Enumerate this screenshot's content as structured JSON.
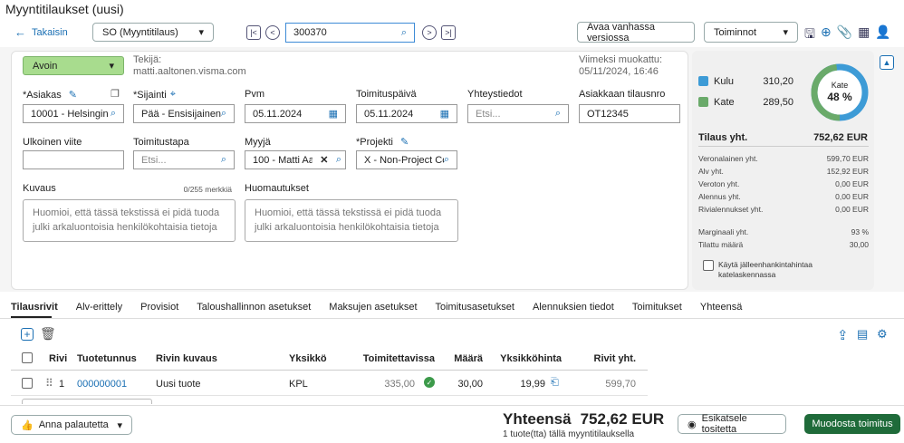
{
  "window": {
    "title": "Myyntitilaukset (uusi)"
  },
  "topbar": {
    "back": "Takaisin",
    "order_type": "SO (Myyntitilaus)",
    "order_number": "300370",
    "open_old": "Avaa vanhassa versiossa",
    "actions": "Toiminnot"
  },
  "header": {
    "status": "Avoin",
    "author_label": "Tekijä:",
    "author": "matti.aaltonen.visma.com",
    "modified_label": "Viimeksi muokattu:",
    "modified": "05/11/2024, 16:46"
  },
  "form": {
    "customer_label": "*Asiakas",
    "customer": "10001 - Helsingin",
    "location_label": "*Sijainti",
    "location": "Pää - Ensisijainen",
    "date_label": "Pvm",
    "date": "05.11.2024",
    "delivery_date_label": "Toimituspäivä",
    "delivery_date": "05.11.2024",
    "contact_label": "Yhteystiedot",
    "contact_placeholder": "Etsi...",
    "customer_order_label": "Asiakkaan tilausnro",
    "customer_order": "OT12345",
    "ext_ref_label": "Ulkoinen viite",
    "ext_ref": "",
    "delivery_method_label": "Toimitustapa",
    "delivery_method_placeholder": "Etsi...",
    "seller_label": "Myyjä",
    "seller": "100 - Matti Aa",
    "project_label": "*Projekti",
    "project": "X - Non-Project Co",
    "description_label": "Kuvaus",
    "description_counter": "0/255 merkkiä",
    "description_placeholder": "Huomioi, että tässä tekstissä ei pidä tuoda julki arkaluontoisia henkilökohtaisia tietoja",
    "notes_label": "Huomautukset",
    "notes_placeholder": "Huomioi, että tässä tekstissä ei pidä tuoda julki arkaluontoisia henkilökohtaisia tietoja"
  },
  "summary": {
    "cost_label": "Kulu",
    "cost": "310,20",
    "margin_label": "Kate",
    "margin": "289,50",
    "donut_label": "Kate",
    "donut_pct": "48 %",
    "donut_fraction": 0.48,
    "total_label": "Tilaus yht.",
    "total": "752,62 EUR",
    "rows": [
      {
        "label": "Veronalainen yht.",
        "value": "599,70 EUR"
      },
      {
        "label": "Alv yht.",
        "value": "152,92 EUR"
      },
      {
        "label": "Veroton yht.",
        "value": "0,00 EUR"
      },
      {
        "label": "Alennus yht.",
        "value": "0,00 EUR"
      },
      {
        "label": "Rivialennukset yht.",
        "value": "0,00 EUR"
      }
    ],
    "rows2": [
      {
        "label": "Marginaali yht.",
        "value": "93 %"
      },
      {
        "label": "Tilattu määrä",
        "value": "30,00"
      }
    ],
    "reuse_label": "Käytä jälleenhankintahintaa katelaskennassa",
    "colors": {
      "cost": "#3d9bd6",
      "margin": "#6aaa6a"
    }
  },
  "tabs": [
    "Tilausrivit",
    "Alv-erittely",
    "Provisiot",
    "Taloushallinnon asetukset",
    "Maksujen asetukset",
    "Toimitusasetukset",
    "Alennuksien tiedot",
    "Toimitukset",
    "Yhteensä"
  ],
  "table": {
    "headers": [
      "Rivi",
      "Tuotetunnus",
      "Rivin kuvaus",
      "Yksikkö",
      "Toimitettavissa",
      "Määrä",
      "Yksikköhinta",
      "Rivit yht."
    ],
    "rows": [
      {
        "line": "1",
        "product": "000000001",
        "description": "Uusi tuote",
        "unit": "KPL",
        "available": "335,00",
        "qty": "30,00",
        "price": "19,99",
        "total": "599,70"
      }
    ]
  },
  "footer": {
    "feedback": "Anna palautetta",
    "total_label": "Yhteensä",
    "total": "752,62 EUR",
    "lines_info": "1 tuote(tta) tällä myyntitilauksella",
    "preview": "Esikatsele tositetta",
    "create": "Muodosta toimitus"
  }
}
